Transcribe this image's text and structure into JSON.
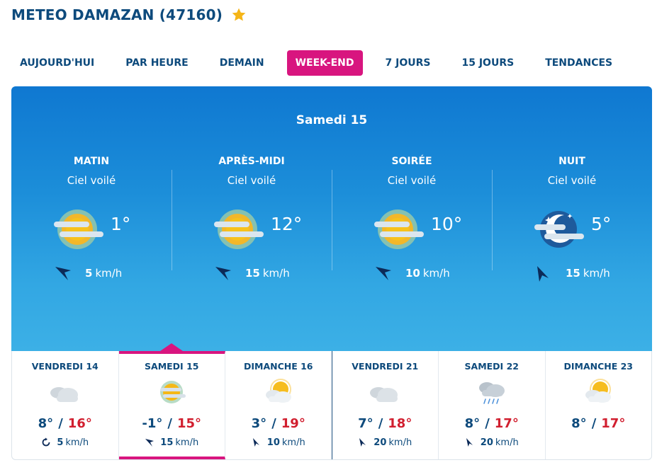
{
  "header": {
    "title": "METEO DAMAZAN (47160)",
    "favorite_icon": "star-icon",
    "star_color": "#f5b517"
  },
  "tabs": [
    {
      "label": "AUJOURD'HUI",
      "active": false
    },
    {
      "label": "PAR HEURE",
      "active": false
    },
    {
      "label": "DEMAIN",
      "active": false
    },
    {
      "label": "WEEK-END",
      "active": true
    },
    {
      "label": "7 JOURS",
      "active": false
    },
    {
      "label": "15 JOURS",
      "active": false
    },
    {
      "label": "TENDANCES",
      "active": false
    }
  ],
  "accent_color": "#d8157f",
  "detail": {
    "date": "Samedi 15",
    "periods": [
      {
        "name": "MATIN",
        "condition": "Ciel voilé",
        "icon": "veiled-sun-icon",
        "temp": "1°",
        "wind_speed": "5",
        "wind_unit": "km/h"
      },
      {
        "name": "APRÈS-MIDI",
        "condition": "Ciel voilé",
        "icon": "veiled-sun-icon",
        "temp": "12°",
        "wind_speed": "15",
        "wind_unit": "km/h"
      },
      {
        "name": "SOIRÉE",
        "condition": "Ciel voilé",
        "icon": "veiled-sun-icon",
        "temp": "10°",
        "wind_speed": "10",
        "wind_unit": "km/h"
      },
      {
        "name": "NUIT",
        "condition": "Ciel voilé",
        "icon": "veiled-moon-icon",
        "temp": "5°",
        "wind_speed": "15",
        "wind_unit": "km/h"
      }
    ]
  },
  "days": [
    {
      "name": "VENDREDI 14",
      "icon": "cloudy-icon",
      "tmin": "8°",
      "tmax": "16°",
      "wind_icon": "variable-wind-icon",
      "wind_speed": "5",
      "wind_unit": "km/h",
      "active": false
    },
    {
      "name": "SAMEDI 15",
      "icon": "veiled-sun-icon",
      "tmin": "-1°",
      "tmax": "15°",
      "wind_icon": "wind-arrow-icon",
      "wind_speed": "15",
      "wind_unit": "km/h",
      "active": true
    },
    {
      "name": "DIMANCHE 16",
      "icon": "partly-cloudy-icon",
      "tmin": "3°",
      "tmax": "19°",
      "wind_icon": "wind-arrow-icon",
      "wind_speed": "10",
      "wind_unit": "km/h",
      "active": false
    },
    {
      "name": "VENDREDI 21",
      "icon": "cloudy-icon",
      "tmin": "7°",
      "tmax": "18°",
      "wind_icon": "wind-arrow-icon",
      "wind_speed": "20",
      "wind_unit": "km/h",
      "active": false
    },
    {
      "name": "SAMEDI 22",
      "icon": "rain-cloud-icon",
      "tmin": "8°",
      "tmax": "17°",
      "wind_icon": "wind-arrow-icon",
      "wind_speed": "20",
      "wind_unit": "km/h",
      "active": false
    },
    {
      "name": "DIMANCHE 23",
      "icon": "partly-cloudy-icon",
      "tmin": "8°",
      "tmax": "17°",
      "wind_icon": "wind-arrow-icon",
      "wind_speed": "",
      "wind_unit": "",
      "active": false
    }
  ]
}
